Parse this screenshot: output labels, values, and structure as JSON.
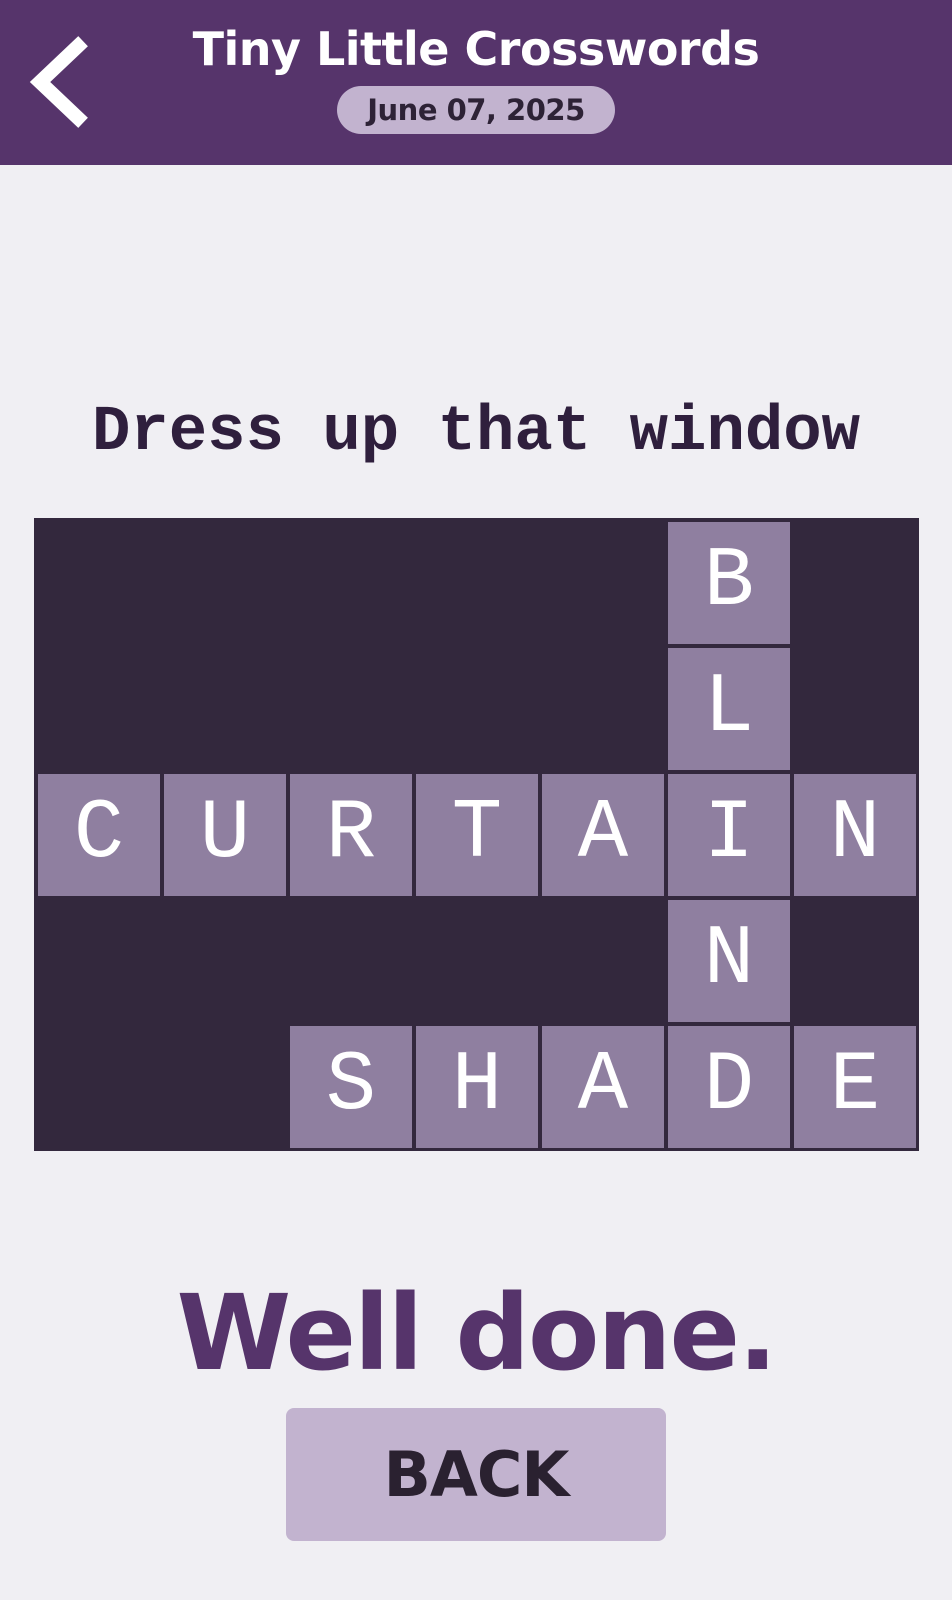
{
  "header": {
    "title": "Tiny Little Crosswords",
    "date": "June 07, 2025",
    "back_icon": "chevron-left-icon"
  },
  "puzzle": {
    "clue": "Dress up that window",
    "rows": 5,
    "cols": 7,
    "cells": [
      {
        "row": 0,
        "col": 5,
        "letter": "B"
      },
      {
        "row": 1,
        "col": 5,
        "letter": "L"
      },
      {
        "row": 2,
        "col": 0,
        "letter": "C"
      },
      {
        "row": 2,
        "col": 1,
        "letter": "U"
      },
      {
        "row": 2,
        "col": 2,
        "letter": "R"
      },
      {
        "row": 2,
        "col": 3,
        "letter": "T"
      },
      {
        "row": 2,
        "col": 4,
        "letter": "A"
      },
      {
        "row": 2,
        "col": 5,
        "letter": "I"
      },
      {
        "row": 2,
        "col": 6,
        "letter": "N"
      },
      {
        "row": 3,
        "col": 5,
        "letter": "N"
      },
      {
        "row": 4,
        "col": 2,
        "letter": "S"
      },
      {
        "row": 4,
        "col": 3,
        "letter": "H"
      },
      {
        "row": 4,
        "col": 4,
        "letter": "A"
      },
      {
        "row": 4,
        "col": 5,
        "letter": "D"
      },
      {
        "row": 4,
        "col": 6,
        "letter": "E"
      }
    ]
  },
  "result": {
    "message": "Well done.",
    "back_button_label": "BACK"
  },
  "colors": {
    "header_bg": "#56346b",
    "page_bg": "#f0eff3",
    "grid_bg": "#33283d",
    "cell_bg": "#8f7fa0",
    "pill_bg": "#c2b3cf",
    "accent_text": "#56346b"
  }
}
